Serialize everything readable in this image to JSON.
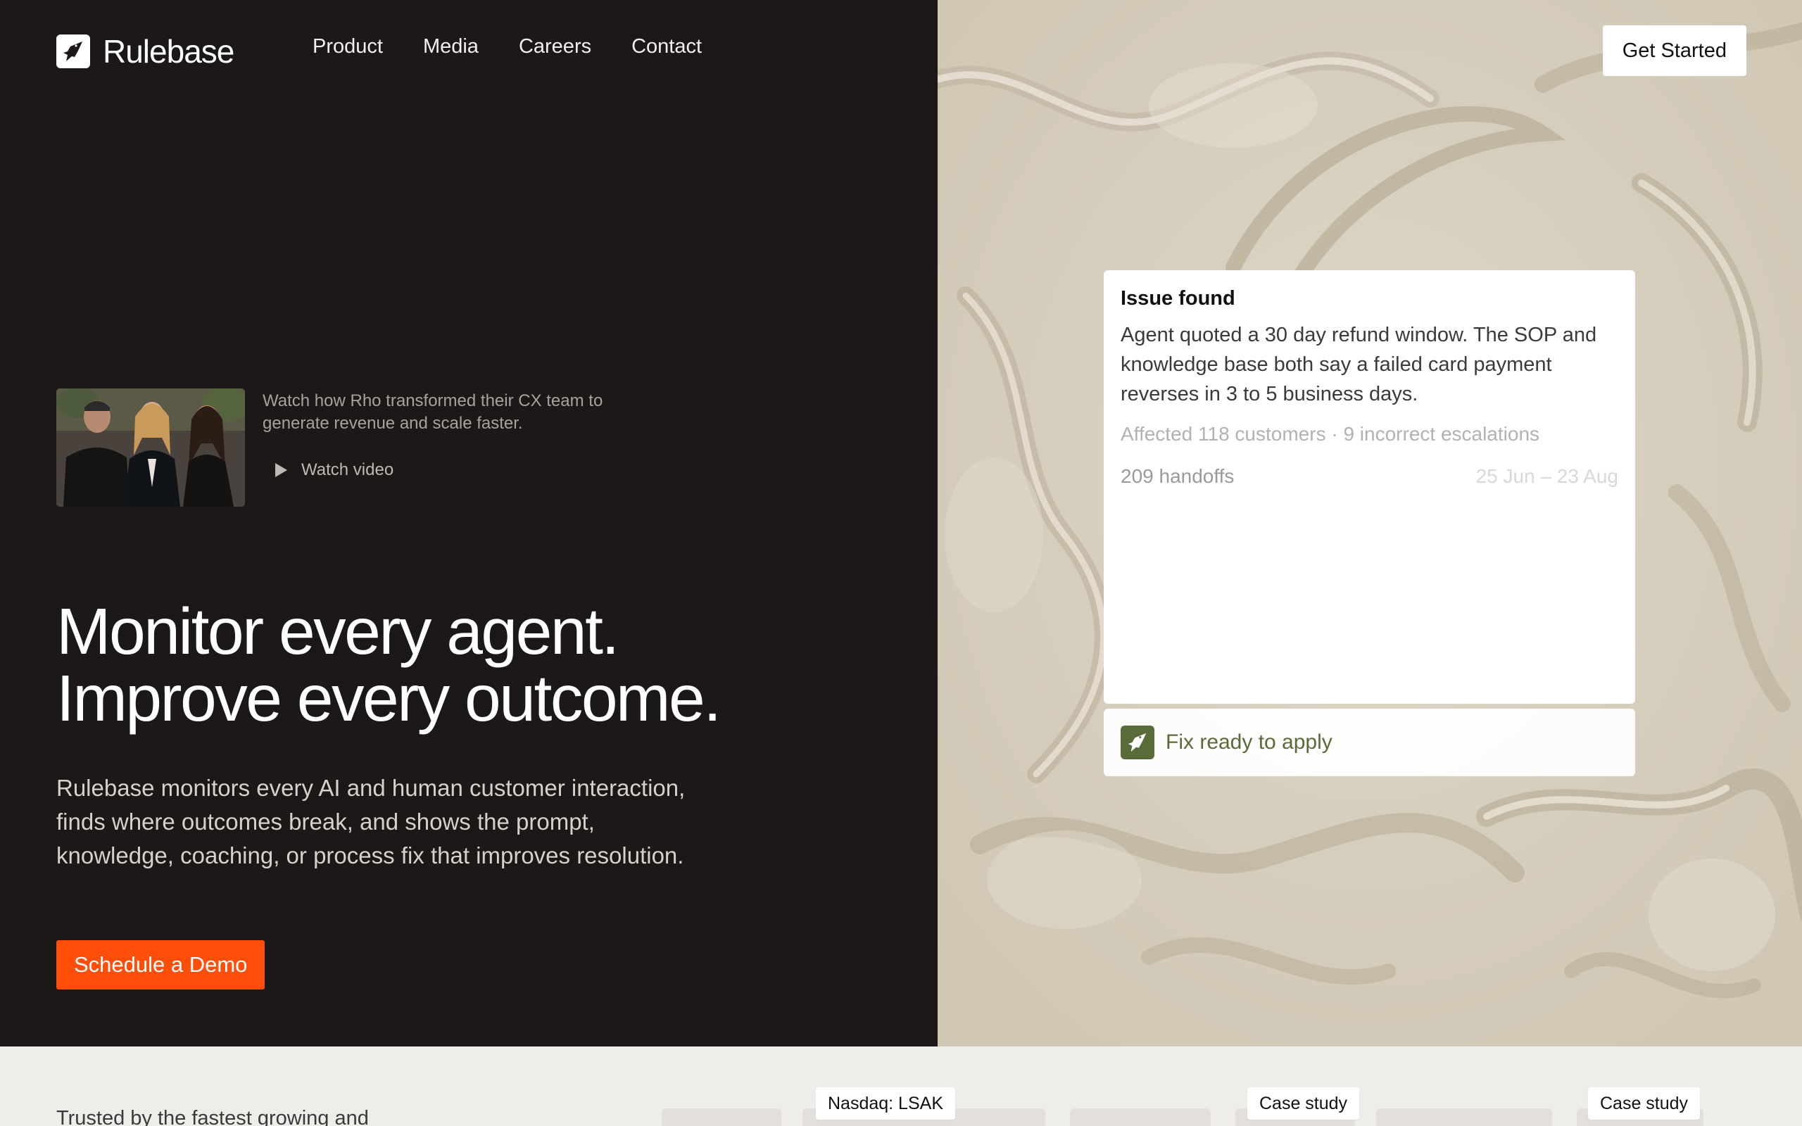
{
  "brand": {
    "name": "Rulebase"
  },
  "nav": {
    "items": [
      "Product",
      "Media",
      "Careers",
      "Contact"
    ]
  },
  "header": {
    "cta_label": "Get Started"
  },
  "video": {
    "description": "Watch how Rho transformed their CX team to generate revenue and scale faster.",
    "watch_label": "Watch video"
  },
  "hero": {
    "headline_line1": "Monitor every agent.",
    "headline_line2": "Improve every outcome.",
    "subtext": "Rulebase monitors every AI and human customer interaction, finds where outcomes break, and shows the prompt, knowledge, coaching, or process fix that improves resolution.",
    "cta_label": "Schedule a Demo"
  },
  "issue_card": {
    "title": "Issue found",
    "body": "Agent quoted a 30 day refund window. The SOP and knowledge base both say a failed card payment reverses in 3 to 5 business days.",
    "meta": "Affected 118 customers · 9 incorrect escalations",
    "handoffs": "209 handoffs",
    "date_range": "25 Jun – 23 Aug"
  },
  "fix_bar": {
    "label": "Fix ready to apply"
  },
  "trust": {
    "heading": "Trusted by the fastest growing and",
    "badges": [
      "Nasdaq: LSAK",
      "Case study",
      "Case study"
    ]
  },
  "colors": {
    "background_dark": "#1c1818",
    "accent_orange": "#ff4d0a",
    "fix_green": "#5a6b3a",
    "plaster": "#d8d0bf",
    "strip": "#efedea"
  },
  "icons": {
    "logo": "rulebase-bird-icon",
    "play": "play-icon",
    "fix": "rulebase-bird-icon"
  }
}
